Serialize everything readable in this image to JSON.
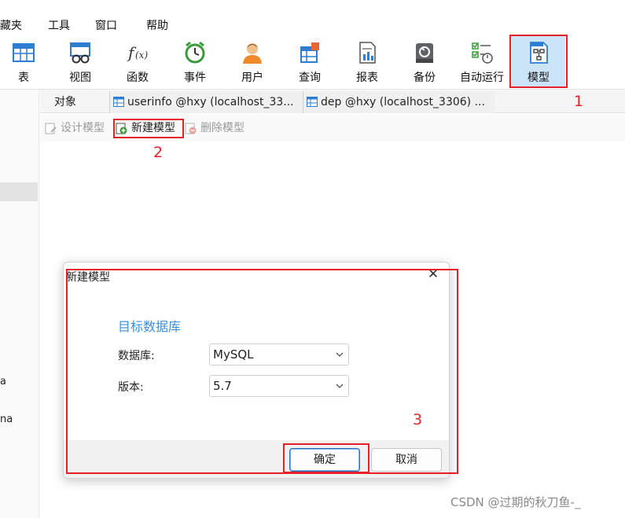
{
  "menu": [
    "藏夹",
    "工具",
    "窗口",
    "帮助"
  ],
  "toolbar": [
    {
      "label": "表",
      "icon": "table-icon"
    },
    {
      "label": "视图",
      "icon": "view-icon"
    },
    {
      "label": "函数",
      "icon": "function-icon"
    },
    {
      "label": "事件",
      "icon": "event-clock-icon"
    },
    {
      "label": "用户",
      "icon": "user-icon"
    },
    {
      "label": "查询",
      "icon": "query-icon"
    },
    {
      "label": "报表",
      "icon": "report-icon"
    },
    {
      "label": "备份",
      "icon": "backup-icon"
    },
    {
      "label": "自动运行",
      "icon": "automation-icon"
    },
    {
      "label": "模型",
      "icon": "model-icon"
    }
  ],
  "tabs": {
    "objects": "对象",
    "tab1": "userinfo @hxy (localhost_33...",
    "tab2": "dep @hxy (localhost_3306) ..."
  },
  "subtoolbar": {
    "design_model": "设计模型",
    "new_model": "新建模型",
    "delete_model": "删除模型"
  },
  "sidebar": {
    "item_a": "a",
    "item_na": "na"
  },
  "annotations": {
    "n1": "1",
    "n2": "2",
    "n3": "3"
  },
  "dialog": {
    "title": "新建模型",
    "close": "✕",
    "section": "目标数据库",
    "database_label": "数据库:",
    "database_value": "MySQL",
    "version_label": "版本:",
    "version_value": "5.7",
    "ok": "确定",
    "cancel": "取消"
  },
  "watermark": "CSDN @过期的秋刀鱼-_",
  "colors": {
    "annotation": "#e5202a",
    "accent": "#3d8fd6",
    "active_tool": "#cce4f7"
  }
}
